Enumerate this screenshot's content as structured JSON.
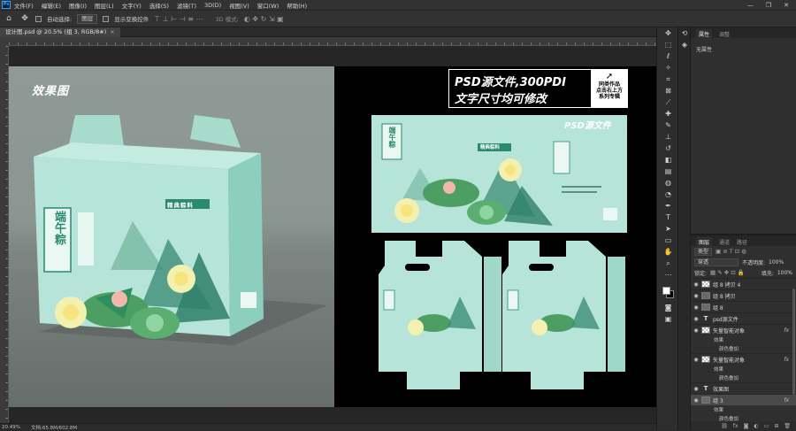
{
  "app": {
    "logo": "Ps",
    "menu": [
      "文件(F)",
      "编辑(E)",
      "图像(I)",
      "图层(L)",
      "文字(Y)",
      "选择(S)",
      "滤镜(T)",
      "3D(D)",
      "视图(V)",
      "窗口(W)",
      "帮助(H)"
    ],
    "window_controls": [
      "—",
      "❐",
      "✕"
    ]
  },
  "options_bar": {
    "auto_select_label": "自动选择:",
    "auto_select_value": "图层",
    "show_transform_label": "显示变换控件",
    "mode_3d_label": "3D 模式:"
  },
  "document": {
    "tab_title": "设计图.psd @ 20.5% (组 3, RGB/8#)",
    "tab_close": "×"
  },
  "canvas": {
    "mockup_title": "效果图",
    "box_brand": "端午粽",
    "box_badge": "精典粽料",
    "banner_line1": "PSD源文件,300PDI",
    "banner_line2": "文字尺寸均可修改",
    "banner_side_1": "同类作品",
    "banner_side_2": "点击右上方",
    "banner_side_3": "系列专辑",
    "flat_badge": "PSD源文件",
    "flat_brand": "端午粽",
    "flat_badge2": "精典粽料",
    "colors": {
      "box": "#b4e3d7",
      "box_dark": "#8fcfbf",
      "brand_green": "#2a8a6e",
      "lotus": "#f3f0b0",
      "leaf": "#4d9e63"
    }
  },
  "status": {
    "zoom": "20.49%",
    "doc_info": "文档:65.8M/602.8M"
  },
  "properties_panel": {
    "tabs": [
      "属性",
      "调整"
    ],
    "body": "无属性"
  },
  "layers_panel": {
    "tabs": [
      "图层",
      "通道",
      "路径"
    ],
    "filter_kind": "类型",
    "blend_mode": "穿透",
    "opacity_label": "不透明度:",
    "opacity_value": "100%",
    "lock_label": "锁定:",
    "fill_label": "填充:",
    "fill_value": "100%",
    "layers": [
      {
        "name": "组 8 拷贝 4",
        "type": "pattern"
      },
      {
        "name": "组 8 拷贝",
        "type": "folder"
      },
      {
        "name": "组 8",
        "type": "folder"
      },
      {
        "name": "psd源文件",
        "type": "text"
      },
      {
        "name": "矢量智能对象",
        "type": "pattern",
        "fx": true
      },
      {
        "name": "矢量智能对象",
        "type": "pattern",
        "fx": true
      },
      {
        "name": "效果图",
        "type": "text"
      },
      {
        "name": "组 3",
        "type": "folder",
        "fx": true,
        "selected": true
      }
    ],
    "effect_label": "效果",
    "effect_item": "颜色叠加"
  }
}
